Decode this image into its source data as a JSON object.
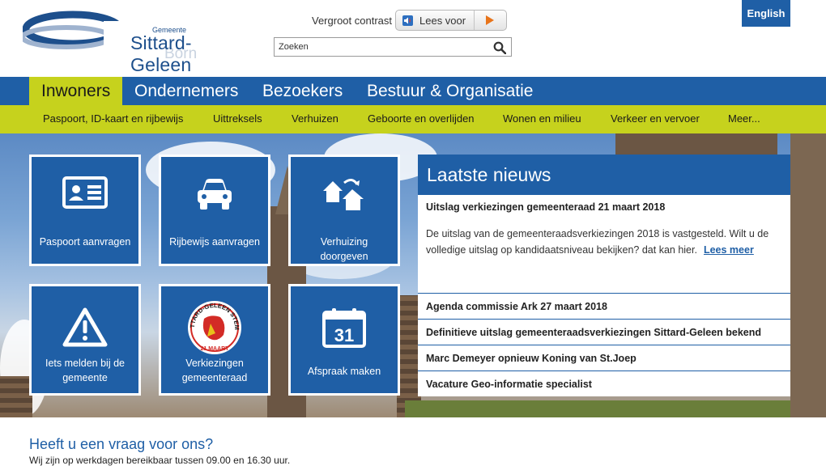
{
  "header": {
    "logo": {
      "small": "Gemeente",
      "name": "Sittard-Geleen",
      "sub": "Born"
    },
    "contrast_label": "Vergroot contrast",
    "lees_voor_label": "Lees voor",
    "search_placeholder": "Zoeken",
    "language_button": "English"
  },
  "main_nav": [
    "Inwoners",
    "Ondernemers",
    "Bezoekers",
    "Bestuur & Organisatie"
  ],
  "sub_nav": [
    "Paspoort, ID-kaart en rijbewijs",
    "Uittreksels",
    "Verhuizen",
    "Geboorte en overlijden",
    "Wonen en milieu",
    "Verkeer en vervoer",
    "Meer..."
  ],
  "tiles": [
    {
      "label": "Paspoort aanvragen",
      "icon": "id-card-icon"
    },
    {
      "label": "Rijbewijs aanvragen",
      "icon": "car-icon"
    },
    {
      "label": "Verhuizing doorgeven",
      "icon": "houses-move-icon"
    },
    {
      "label": "Iets melden bij de gemeente",
      "icon": "warning-icon"
    },
    {
      "label": "Verkiezingen gemeenteraad",
      "icon": "election-stamp-icon",
      "stamp_text": "SITTARD-GELEEN STEMT",
      "stamp_date": "21 MAART"
    },
    {
      "label": "Afspraak maken",
      "icon": "calendar-icon",
      "calendar_day": "31"
    }
  ],
  "news": {
    "heading": "Laatste nieuws",
    "first": {
      "title": "Uitslag verkiezingen gemeenteraad 21 maart 2018",
      "text": "De uitslag van de gemeenteraadsverkiezingen 2018 is vastgesteld. Wilt u de volledige uitslag op kandidaatsniveau bekijken? dat kan hier.",
      "more": "Lees meer"
    },
    "items": [
      "Agenda commissie Ark 27 maart 2018",
      "Definitieve uitslag gemeenteraadsverkiezingen Sittard-Geleen bekend",
      "Marc Demeyer opnieuw Koning van St.Joep",
      "Vacature Geo-informatie specialist"
    ]
  },
  "contact": {
    "title": "Heeft u een vraag voor ons?",
    "text": "Wij zijn op werkdagen bereikbaar tussen 09.00 en 16.30 uur."
  },
  "colors": {
    "brand_blue": "#1f5fa6",
    "accent_green": "#c6d21d"
  }
}
